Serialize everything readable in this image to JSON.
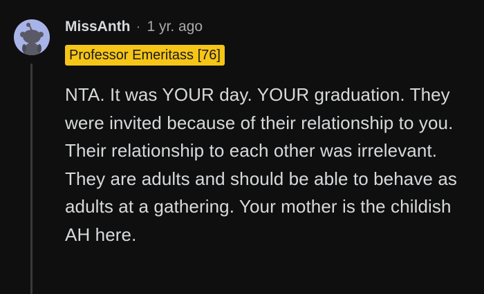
{
  "comment": {
    "author": "MissAnth",
    "separator": "·",
    "age": "1 yr. ago",
    "flair": "Professor Emeritass [76]",
    "body": "NTA. It was YOUR day. YOUR graduation. They were invited because of their relationship to you. Their relationship to each other was irrelevant. They are adults and should be able to behave as adults at a gathering. Your mother is the childish AH here.",
    "avatar_icon": "reddit-snoo-avatar-icon"
  },
  "colors": {
    "background": "#0f0f0f",
    "avatar_bg": "#a8b4e8",
    "flair_bg": "#f5c518",
    "text": "#d7dadc",
    "muted": "#a8aaab",
    "thread_line": "#3a3a3c"
  }
}
